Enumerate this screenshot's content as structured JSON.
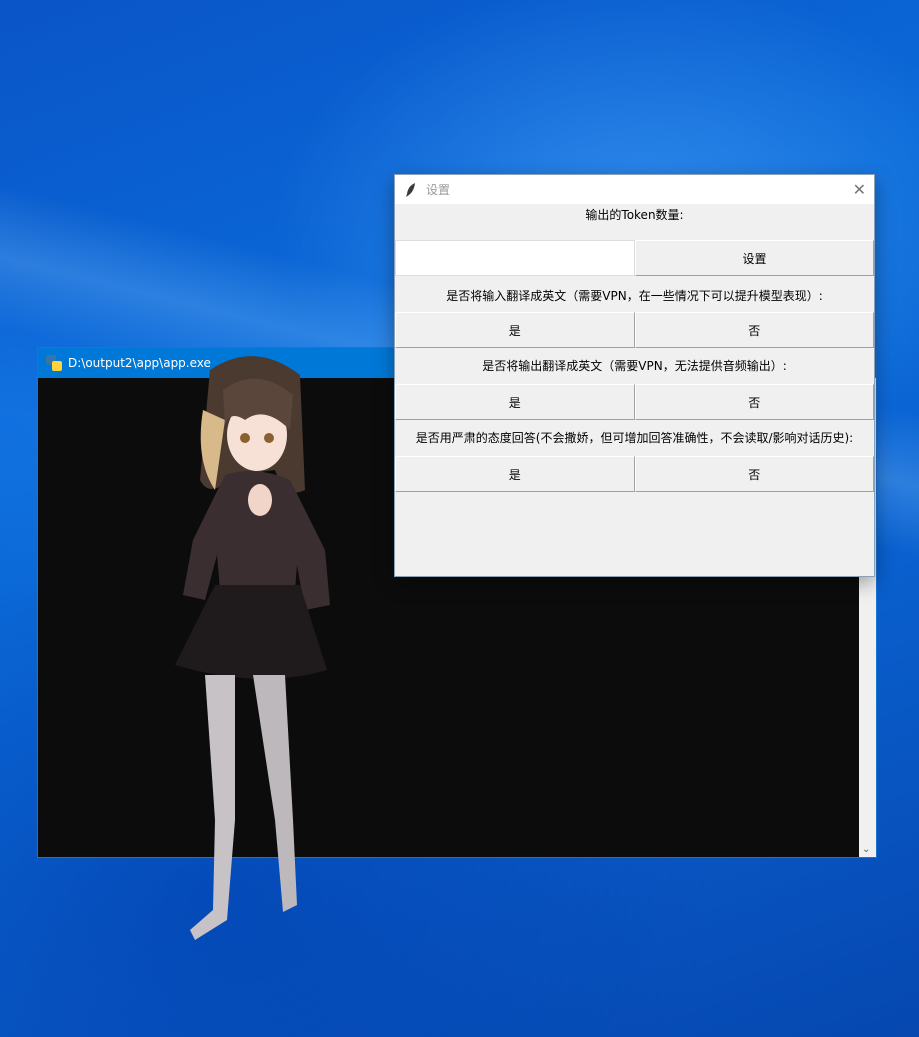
{
  "console": {
    "title": "D:\\output2\\app\\app.exe",
    "scroll_down_glyph": "⌄"
  },
  "settings": {
    "title": "设置",
    "close_glyph": "✕",
    "token_label": "输出的Token数量:",
    "token_value": "",
    "set_button": "设置",
    "translate_input_label": "是否将输入翻译成英文（需要VPN，在一些情况下可以提升模型表现）:",
    "translate_output_label": "是否将输出翻译成英文（需要VPN，无法提供音频输出）:",
    "serious_label": "是否用严肃的态度回答(不会撒娇，但可增加回答准确性，不会读取/影响对话历史):",
    "yes": "是",
    "no": "否"
  },
  "colors": {
    "desktop": "#0a63d2",
    "console_title": "#0078d7",
    "console_bg": "#0c0c0c",
    "dialog_bg": "#f0f0f0"
  }
}
